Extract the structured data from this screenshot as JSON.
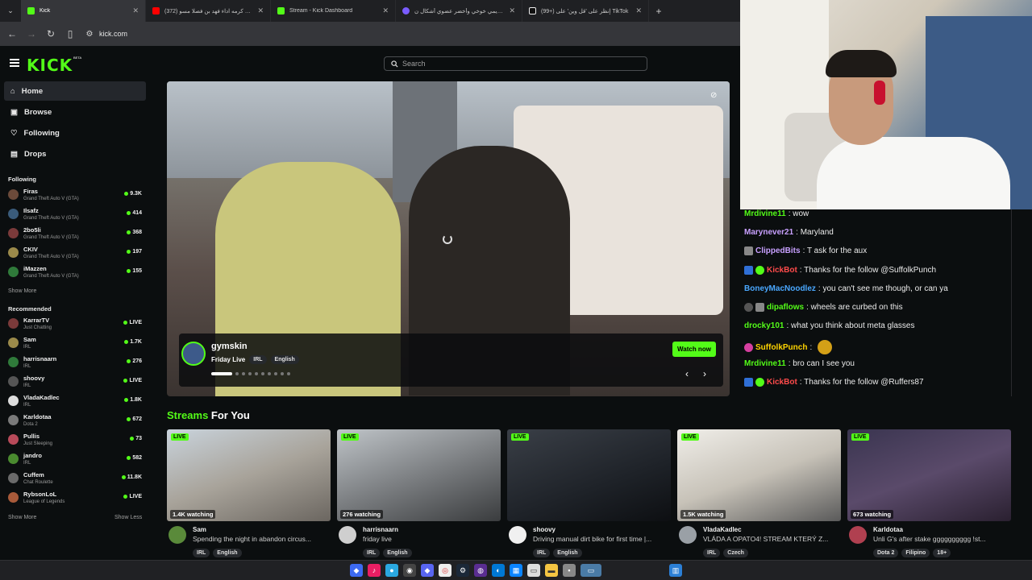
{
  "browser": {
    "tabs": [
      {
        "label": "Kick",
        "active": true
      },
      {
        "label": "(372) فكر فكين كرمه اداء فهد بن فصلا مسو",
        "active": false
      },
      {
        "label": "Stream - Kick Dashboard",
        "active": false
      },
      {
        "label": "عرض تقديمي خوخي وأخضر عضوي أشكال ن",
        "active": false
      },
      {
        "label": "(99+) إنظر على 'قل وين' على TikTok",
        "active": false
      }
    ],
    "url": "kick.com"
  },
  "header": {
    "logo": "KICK",
    "beta": "BETA",
    "search_placeholder": "Search"
  },
  "sidebar": {
    "nav": [
      {
        "label": "Home",
        "icon": "home-icon"
      },
      {
        "label": "Browse",
        "icon": "browse-icon"
      },
      {
        "label": "Following",
        "icon": "heart-icon"
      },
      {
        "label": "Drops",
        "icon": "drops-icon"
      }
    ],
    "following_title": "Following",
    "following": [
      {
        "name": "Firas",
        "game": "Grand Theft Auto V (GTA)",
        "viewers": "9.3K"
      },
      {
        "name": "Ilsafz",
        "game": "Grand Theft Auto V (GTA)",
        "viewers": "414"
      },
      {
        "name": "2bo5li",
        "game": "Grand Theft Auto V (GTA)",
        "viewers": "368"
      },
      {
        "name": "CKIV",
        "game": "Grand Theft Auto V (GTA)",
        "viewers": "197"
      },
      {
        "name": "iMazzen",
        "game": "Grand Theft Auto V (GTA)",
        "viewers": "155"
      }
    ],
    "show_more_following": "Show More",
    "recommended_title": "Recommended",
    "recommended": [
      {
        "name": "KarrarTV",
        "game": "Just Chatting",
        "viewers": "LIVE"
      },
      {
        "name": "Sam",
        "game": "IRL",
        "viewers": "1.7K"
      },
      {
        "name": "harrisnaarn",
        "game": "IRL",
        "viewers": "276"
      },
      {
        "name": "shoovy",
        "game": "IRL",
        "viewers": "LIVE"
      },
      {
        "name": "VladaKadlec",
        "game": "IRL",
        "viewers": "1.8K"
      },
      {
        "name": "Karldotaa",
        "game": "Dota 2",
        "viewers": "672"
      },
      {
        "name": "Pullis",
        "game": "Just Sleeping",
        "viewers": "73"
      },
      {
        "name": "jandro",
        "game": "IRL",
        "viewers": "582"
      },
      {
        "name": "Cuffem",
        "game": "Chat Roulette",
        "viewers": "11.8K"
      },
      {
        "name": "RybsonLoL",
        "game": "League of Legends",
        "viewers": "LIVE"
      }
    ],
    "show_more_recommended": "Show More",
    "show_less": "Show Less"
  },
  "hero": {
    "streamer": "gymskin",
    "title": "Friday Live",
    "tags": [
      "IRL",
      "English"
    ],
    "watch_now": "Watch now",
    "carousel_dots": 10,
    "active_dot": 0
  },
  "chat": {
    "messages": [
      {
        "user": "Mrdivine11",
        "color": "#53fc18",
        "text": ": wow",
        "badges": []
      },
      {
        "user": "Marynever21",
        "color": "#c8a0ff",
        "text": ": Maryland",
        "badges": []
      },
      {
        "user": "ClippedBits",
        "color": "#c8a0ff",
        "text": ": T ask for the aux",
        "badges": [
          "gift"
        ]
      },
      {
        "user": "KickBot",
        "color": "#ff4b4b",
        "text": ": Thanks for the follow @SuffolkPunch",
        "badges": [
          "mod",
          "verified"
        ]
      },
      {
        "user": "BoneyMacNoodlez",
        "color": "#4aa8ff",
        "text": ": you can't see me though, or can ya",
        "badges": []
      },
      {
        "user": "dipaflows",
        "color": "#53fc18",
        "text": ": wheels are curbed on this",
        "badges": [
          "sub",
          "gift"
        ]
      },
      {
        "user": "drocky101",
        "color": "#53fc18",
        "text": ": what you think about meta glasses",
        "badges": []
      },
      {
        "user": "SuffolkPunch",
        "color": "#ffd400",
        "text": ":",
        "badges": [
          "sub27"
        ]
      },
      {
        "user": "Mrdivine11",
        "color": "#53fc18",
        "text": ": bro can I see you",
        "badges": []
      },
      {
        "user": "KickBot",
        "color": "#ff4b4b",
        "text": ": Thanks for the follow @Ruffers87",
        "badges": [
          "mod",
          "verified"
        ]
      }
    ]
  },
  "streams_section": {
    "title_accent": "Streams",
    "title_rest": " For You",
    "cards": [
      {
        "live": "LIVE",
        "watching": "1.4K watching",
        "name": "Sam",
        "title": "Spending the night in abandon circus...",
        "tags": [
          "IRL",
          "English"
        ]
      },
      {
        "live": "LIVE",
        "watching": "276 watching",
        "name": "harrisnaarn",
        "title": "friday live",
        "tags": [
          "IRL",
          "English"
        ]
      },
      {
        "live": "LIVE",
        "watching": "",
        "name": "shoovy",
        "title": "Driving manual dirt bike for first time |...",
        "tags": [
          "IRL",
          "English"
        ]
      },
      {
        "live": "LIVE",
        "watching": "1.5K watching",
        "name": "VladaKadlec",
        "title": "VLÁDA A OPATO4! STREAM KTERÝ Z...",
        "tags": [
          "IRL",
          "Czech"
        ]
      },
      {
        "live": "LIVE",
        "watching": "673 watching",
        "name": "Karldotaa",
        "title": "Unli G's after stake gggggggggg !st...",
        "tags": [
          "Dota 2",
          "Filipino",
          "18+"
        ]
      }
    ]
  },
  "colors": {
    "accent": "#53fc18",
    "bg": "#0b0e0f"
  }
}
